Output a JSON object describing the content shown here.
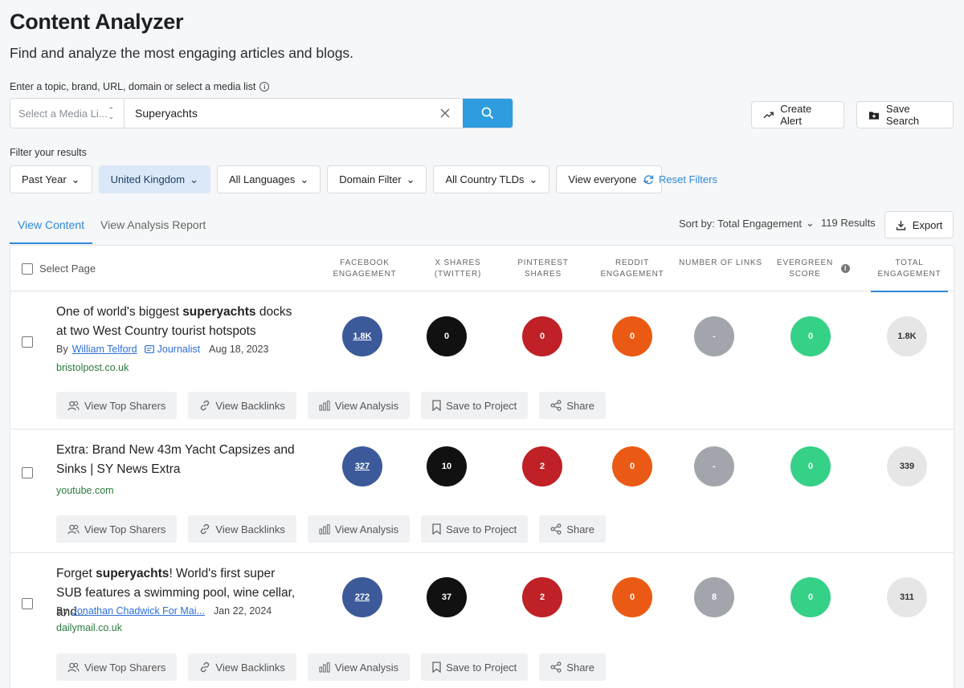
{
  "header": {
    "title": "Content Analyzer",
    "subtitle": "Find and analyze the most engaging articles and blogs."
  },
  "search": {
    "label": "Enter a topic, brand, URL, domain or select a media list",
    "media_placeholder": "Select a Media Li...",
    "query": "Superyachts",
    "clear_icon": "close-icon",
    "search_icon": "search-icon",
    "button_color": "#2e9de0"
  },
  "actions": {
    "create_alert": "Create Alert",
    "save_search": "Save Search"
  },
  "filters": {
    "label": "Filter your results",
    "items": [
      "Past Year",
      "United Kingdom",
      "All Languages",
      "Domain Filter",
      "All Country TLDs",
      "View everyone"
    ],
    "active": "United Kingdom",
    "reset": "Reset Filters"
  },
  "tabs": [
    "View Content",
    "View Analysis Report"
  ],
  "active_tab": "View Content",
  "toolbar": {
    "sort": "Sort by: Total Engagement",
    "results": "119 Results",
    "export": "Export"
  },
  "table": {
    "select_page": "Select Page",
    "columns": {
      "facebook": "FACEBOOK ENGAGEMENT",
      "x": "X SHARES (TWITTER)",
      "pinterest": "PINTEREST SHARES",
      "reddit": "REDDIT ENGAGEMENT",
      "links": "NUMBER OF LINKS",
      "evergreen": "EVERGREEN SCORE",
      "total": "TOTAL ENGAGEMENT"
    },
    "sorted_column": "total",
    "colors": {
      "facebook": "#3c5a9a",
      "x": "#111111",
      "pinterest": "#bf2126",
      "reddit": "#eb5a14",
      "links": "#a2a6ac",
      "evergreen": "#34d187",
      "total": "#e6e6e7"
    },
    "row_actions": [
      "View Top Sharers",
      "View Backlinks",
      "View Analysis",
      "Save to Project",
      "Share"
    ],
    "rows": [
      {
        "title_pre": "One of world's biggest ",
        "title_bold": "superyachts",
        "title_post": " docks at two West Country tourist hotspots",
        "by": "By",
        "author": "William Telford",
        "journalist": "Journalist",
        "date": "Aug 18, 2023",
        "domain": "bristolpost.co.uk",
        "facebook": "1.8K",
        "x": "0",
        "pinterest": "0",
        "reddit": "0",
        "links": "-",
        "evergreen": "0",
        "total": "1.8K"
      },
      {
        "title_pre": "Extra: Brand New 43m Yacht Capsizes and Sinks | SY News Extra",
        "title_bold": "",
        "title_post": "",
        "domain": "youtube.com",
        "facebook": "327",
        "x": "10",
        "pinterest": "2",
        "reddit": "0",
        "links": "-",
        "evergreen": "0",
        "total": "339"
      },
      {
        "title_pre": "Forget ",
        "title_bold": "superyachts",
        "title_post": "! World's first super SUB features a swimming pool, wine cellar, and...",
        "by": "By",
        "author": "Jonathan Chadwick For Mai...",
        "date": "Jan 22, 2024",
        "domain": "dailymail.co.uk",
        "facebook": "272",
        "x": "37",
        "pinterest": "2",
        "reddit": "0",
        "links": "8",
        "evergreen": "0",
        "total": "311"
      }
    ]
  }
}
